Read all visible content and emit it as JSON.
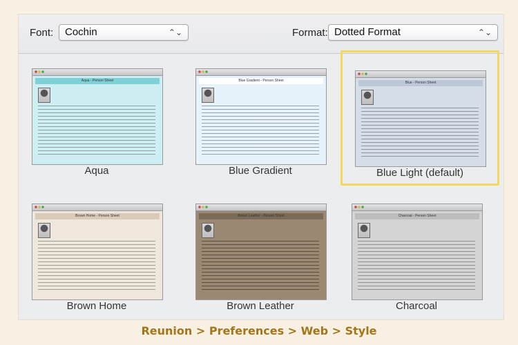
{
  "toolbar": {
    "font_label": "Font:",
    "font_value": "Cochin",
    "format_label": "Format:",
    "format_value": "Dotted Format",
    "popup_arrows": "⌃⌄"
  },
  "styles": [
    {
      "label": "Aqua",
      "page_title": "Aqua - Person Sheet",
      "bg": "#cdeef2",
      "header_bg": "#7fd1d8",
      "selected": false
    },
    {
      "label": "Blue Gradient",
      "page_title": "Blue Gradient - Person Sheet",
      "bg": "#e6f3fb",
      "header_bg": "#ffffff",
      "selected": false
    },
    {
      "label": "Blue Light (default)",
      "page_title": "Blue - Person Sheet",
      "bg": "#d5dde8",
      "header_bg": "#bcc8d8",
      "selected": true
    },
    {
      "label": "Brown Home",
      "page_title": "Brown Home - Person Sheet",
      "bg": "#efe7dc",
      "header_bg": "#d9cbb8",
      "selected": false
    },
    {
      "label": "Brown Leather",
      "page_title": "Brown Leather - Person Sheet",
      "bg": "#9b8873",
      "header_bg": "#7c6a58",
      "selected": false
    },
    {
      "label": "Charcoal",
      "page_title": "Charcoal - Person Sheet",
      "bg": "#d4d4d4",
      "header_bg": "#bdbdbd",
      "selected": false
    }
  ],
  "footer": {
    "path": "Reunion > Preferences > Web > Style"
  },
  "colors": {
    "accent": "#a3761a",
    "selection": "#f3d65a"
  }
}
